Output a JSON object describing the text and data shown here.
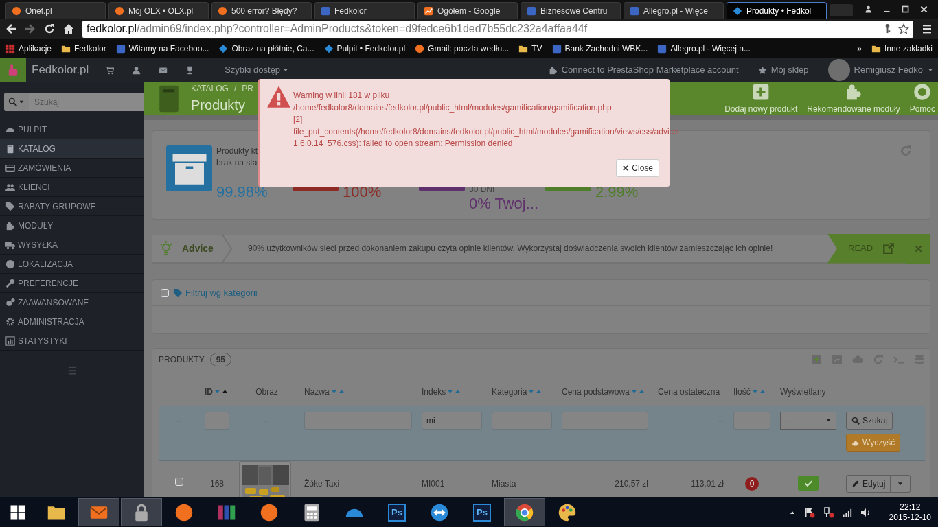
{
  "browser": {
    "tabs": [
      {
        "title": "Onet.pl",
        "selected": false
      },
      {
        "title": "Mój OLX • OLX.pl",
        "selected": false
      },
      {
        "title": "500 error? Błędy?",
        "selected": false
      },
      {
        "title": "Fedkolor",
        "selected": false
      },
      {
        "title": "Ogółem - Google",
        "selected": false
      },
      {
        "title": "Biznesowe Centru",
        "selected": false
      },
      {
        "title": "Allegro.pl - Więce",
        "selected": false
      },
      {
        "title": "Produkty • Fedkol",
        "selected": true
      }
    ],
    "address": {
      "domain": "fedkolor.pl",
      "path": "/admin69/index.php?controller=AdminProducts&token=d9fedce6b1ded7b55dc232a4affaa44f"
    },
    "bookmarks": [
      {
        "label": "Aplikacje"
      },
      {
        "label": "Fedkolor"
      },
      {
        "label": "Witamy na Faceboo..."
      },
      {
        "label": "Obraz na płótnie, Ca..."
      },
      {
        "label": "Pulpit • Fedkolor.pl"
      },
      {
        "label": "Gmail: poczta wedłu..."
      },
      {
        "label": "TV"
      },
      {
        "label": "Bank Zachodni WBK..."
      },
      {
        "label": "Allegro.pl - Więcej n..."
      }
    ],
    "more_bookmarks": "»",
    "other_bookmarks": "Inne zakładki"
  },
  "admin_bar": {
    "shop_name": "Fedkolor.pl",
    "quick_access": "Szybki dostęp",
    "connect": "Connect to PrestaShop Marketplace account",
    "my_shop": "Mój sklep",
    "user": "Remigiusz Fedko"
  },
  "sidebar": {
    "search_placeholder": "Szukaj",
    "items": [
      {
        "label": "PULPIT",
        "selected": false
      },
      {
        "label": "KATALOG",
        "selected": true
      },
      {
        "label": "ZAMÓWIENIA",
        "selected": false
      },
      {
        "label": "KLIENCI",
        "selected": false
      },
      {
        "label": "RABATY GRUPOWE",
        "selected": false
      },
      {
        "label": "MODUŁY",
        "selected": false
      },
      {
        "label": "WYSYŁKA",
        "selected": false
      },
      {
        "label": "LOKALIZACJA",
        "selected": false
      },
      {
        "label": "PREFERENCJE",
        "selected": false
      },
      {
        "label": "ZAAWANSOWANE",
        "selected": false
      },
      {
        "label": "ADMINISTRACJA",
        "selected": false
      },
      {
        "label": "STATYSTYKI",
        "selected": false
      }
    ]
  },
  "page_header": {
    "breadcrumb": [
      "KATALOG",
      "/",
      "PR"
    ],
    "title": "Produkty",
    "toolbar": [
      {
        "label": "Dodaj nowy produkt"
      },
      {
        "label": "Rekomendowane moduły"
      },
      {
        "label": "Pomoc"
      }
    ]
  },
  "kpis": [
    {
      "color": "#2470a0",
      "texts": [
        {
          "kind": "label",
          "text": "Produkty kt"
        },
        {
          "kind": "label",
          "text": "brak na sta"
        },
        {
          "kind": "value",
          "text": "99.98%"
        }
      ]
    },
    {
      "color": "#8e2a24",
      "texts": [
        {
          "kind": "value",
          "text": "100%"
        }
      ]
    },
    {
      "color": "#5f306c",
      "texts": [
        {
          "kind": "caption",
          "text": "30 DNI"
        },
        {
          "kind": "value",
          "text": "0% Twoj..."
        }
      ]
    },
    {
      "color": "#4f7d2a",
      "texts": [
        {
          "kind": "value",
          "text": "2.99%"
        }
      ]
    }
  ],
  "advice": {
    "title": "Advice",
    "text": "90% użytkowników sieci przed dokonaniem zakupu czyta opinie klientów. Wykorzystaj doświadczenia swoich klientów zamieszczając ich opinie!",
    "action": "READ"
  },
  "filter": {
    "checked": false,
    "label": "Filtruj wg kategorii"
  },
  "products": {
    "title": "PRODUKTY",
    "count": "95",
    "columns": [
      {
        "label": "ID",
        "sorted": true
      },
      {
        "label": "Obraz"
      },
      {
        "label": "Nazwa",
        "sorted": false
      },
      {
        "label": "Indeks",
        "sorted": false
      },
      {
        "label": "Kategoria",
        "sorted": false
      },
      {
        "label": "Cena podstawowa",
        "sorted": false
      },
      {
        "label": "Cena ostateczna"
      },
      {
        "label": "Ilość",
        "sorted": false
      },
      {
        "label": "Wyświetlany"
      }
    ],
    "filters": [
      {
        "kind": "dash",
        "text": "--"
      },
      {
        "kind": "input"
      },
      {
        "kind": "dash",
        "text": "--"
      },
      {
        "kind": "input"
      },
      {
        "kind": "input",
        "value": "mi"
      },
      {
        "kind": "input"
      },
      {
        "kind": "input"
      },
      {
        "kind": "dash",
        "text": "--"
      },
      {
        "kind": "input"
      },
      {
        "kind": "select",
        "value": "-"
      }
    ],
    "search_button": "Szukaj",
    "reset_button": "Wyczyść",
    "rows": [
      {
        "selected": false,
        "id": "168",
        "name": "Żółte Taxi",
        "index": "MI001",
        "category": "Miasta",
        "base_price": "210,57 zł",
        "final_price": "113,01 zł",
        "quantity": "0",
        "displayed": true,
        "edit": "Edytuj"
      }
    ]
  },
  "modal": {
    "lines": [
      "Warning w linii 181 w pliku",
      "/home/fedkolor8/domains/fedkolor.pl/public_html/modules/gamification/gamification.php",
      "[2]",
      "file_put_contents(/home/fedkolor8/domains/fedkolor.pl/public_html/modules/gamification/views/css/advice-",
      "1.6.0.14_576.css): failed to open stream: Permission denied"
    ],
    "close": "Close"
  },
  "taskbar": {
    "apps": [
      {
        "selected": false
      },
      {
        "selected": true
      },
      {
        "selected": true
      },
      {
        "selected": false
      },
      {
        "selected": false
      },
      {
        "selected": false
      },
      {
        "selected": false
      },
      {
        "selected": false
      },
      {
        "label": "Ps",
        "selected": false
      },
      {
        "selected": false
      },
      {
        "label": "Ps",
        "selected": false
      },
      {
        "selected": true
      },
      {
        "selected": false
      }
    ],
    "time": "22:12",
    "date": "2015-12-10"
  }
}
